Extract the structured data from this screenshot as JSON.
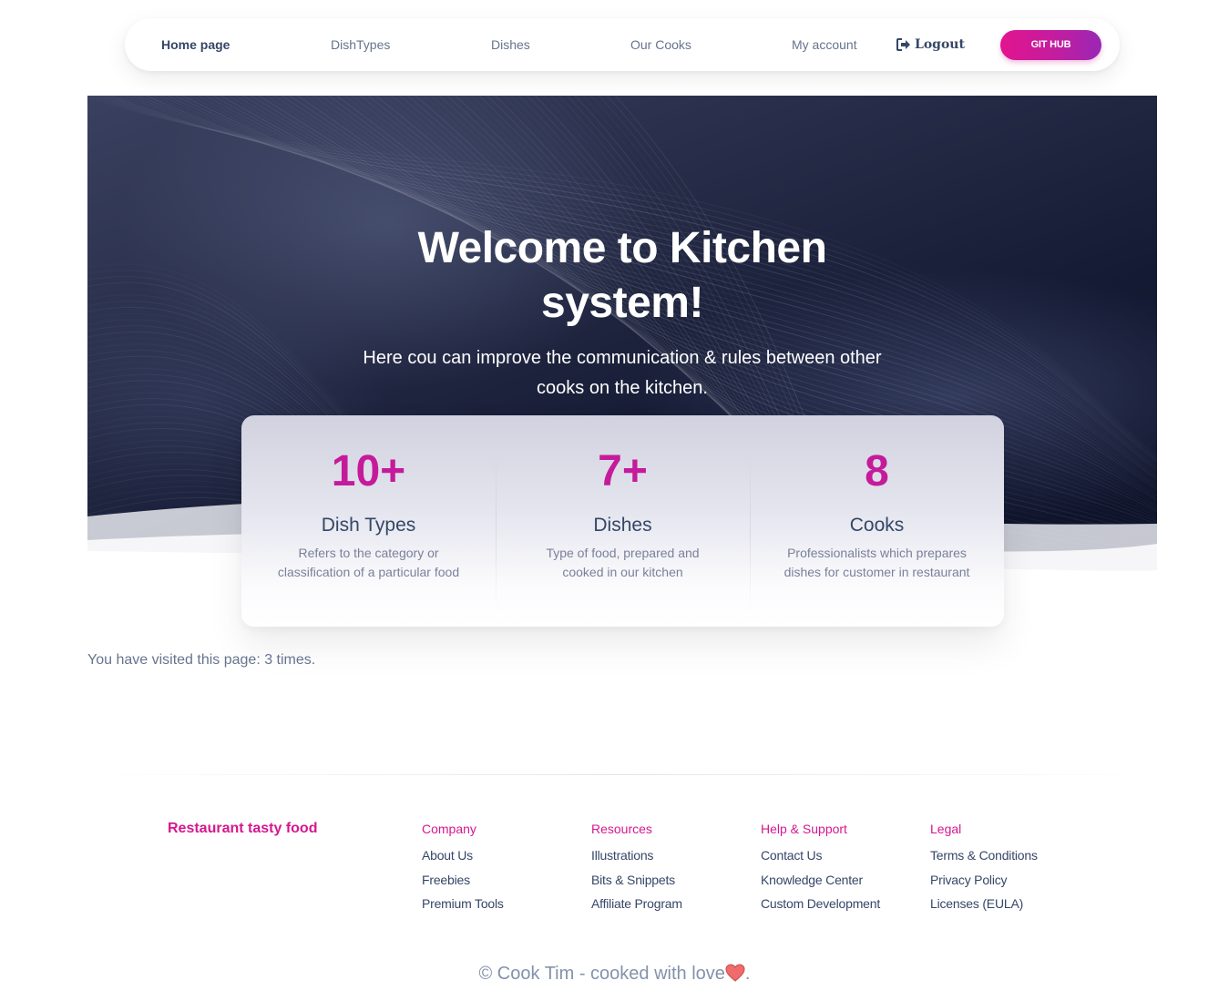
{
  "nav": {
    "home": "Home page",
    "dish_types": "DishTypes",
    "dishes": "Dishes",
    "our_cooks": "Our Cooks",
    "my_account": "My account",
    "logout": "Logout",
    "github": "GIT HUB"
  },
  "hero": {
    "title_line1": "Welcome to Kitchen",
    "title_line2": "system!",
    "subtitle_line1": "Here cou can improve the communication & rules between other",
    "subtitle_line2": "cooks on the kitchen."
  },
  "stats": [
    {
      "value": "10+",
      "label": "Dish Types",
      "desc_line1": "Refers to the category or",
      "desc_line2": "classification of a particular food"
    },
    {
      "value": "7+",
      "label": "Dishes",
      "desc_line1": "Type of food, prepared and",
      "desc_line2": "cooked in our kitchen"
    },
    {
      "value": "8",
      "label": "Cooks",
      "desc_line1": "Professionalists which prepares",
      "desc_line2": "dishes for customer in restaurant"
    }
  ],
  "visits_text": "You have visited this page: 3 times.",
  "footer": {
    "brand": "Restaurant tasty food",
    "columns": [
      {
        "title": "Company",
        "links": [
          "About Us",
          "Freebies",
          "Premium Tools"
        ]
      },
      {
        "title": "Resources",
        "links": [
          "Illustrations",
          "Bits & Snippets",
          "Affiliate Program"
        ]
      },
      {
        "title": "Help & Support",
        "links": [
          "Contact Us",
          "Knowledge Center",
          "Custom Development"
        ]
      },
      {
        "title": "Legal",
        "links": [
          "Terms & Conditions",
          "Privacy Policy",
          "Licenses (EULA)"
        ]
      }
    ],
    "copyright_prefix": "© Cook Tim - cooked with love",
    "copyright_suffix": "."
  },
  "colors": {
    "accent": "#d6178f",
    "stat_number": "#c51b9b",
    "hero_dark": "#141a33",
    "text_dark": "#344767",
    "text_muted": "#67748e"
  },
  "icons": {
    "logout": "sign-out-icon",
    "heart": "heart-icon"
  }
}
